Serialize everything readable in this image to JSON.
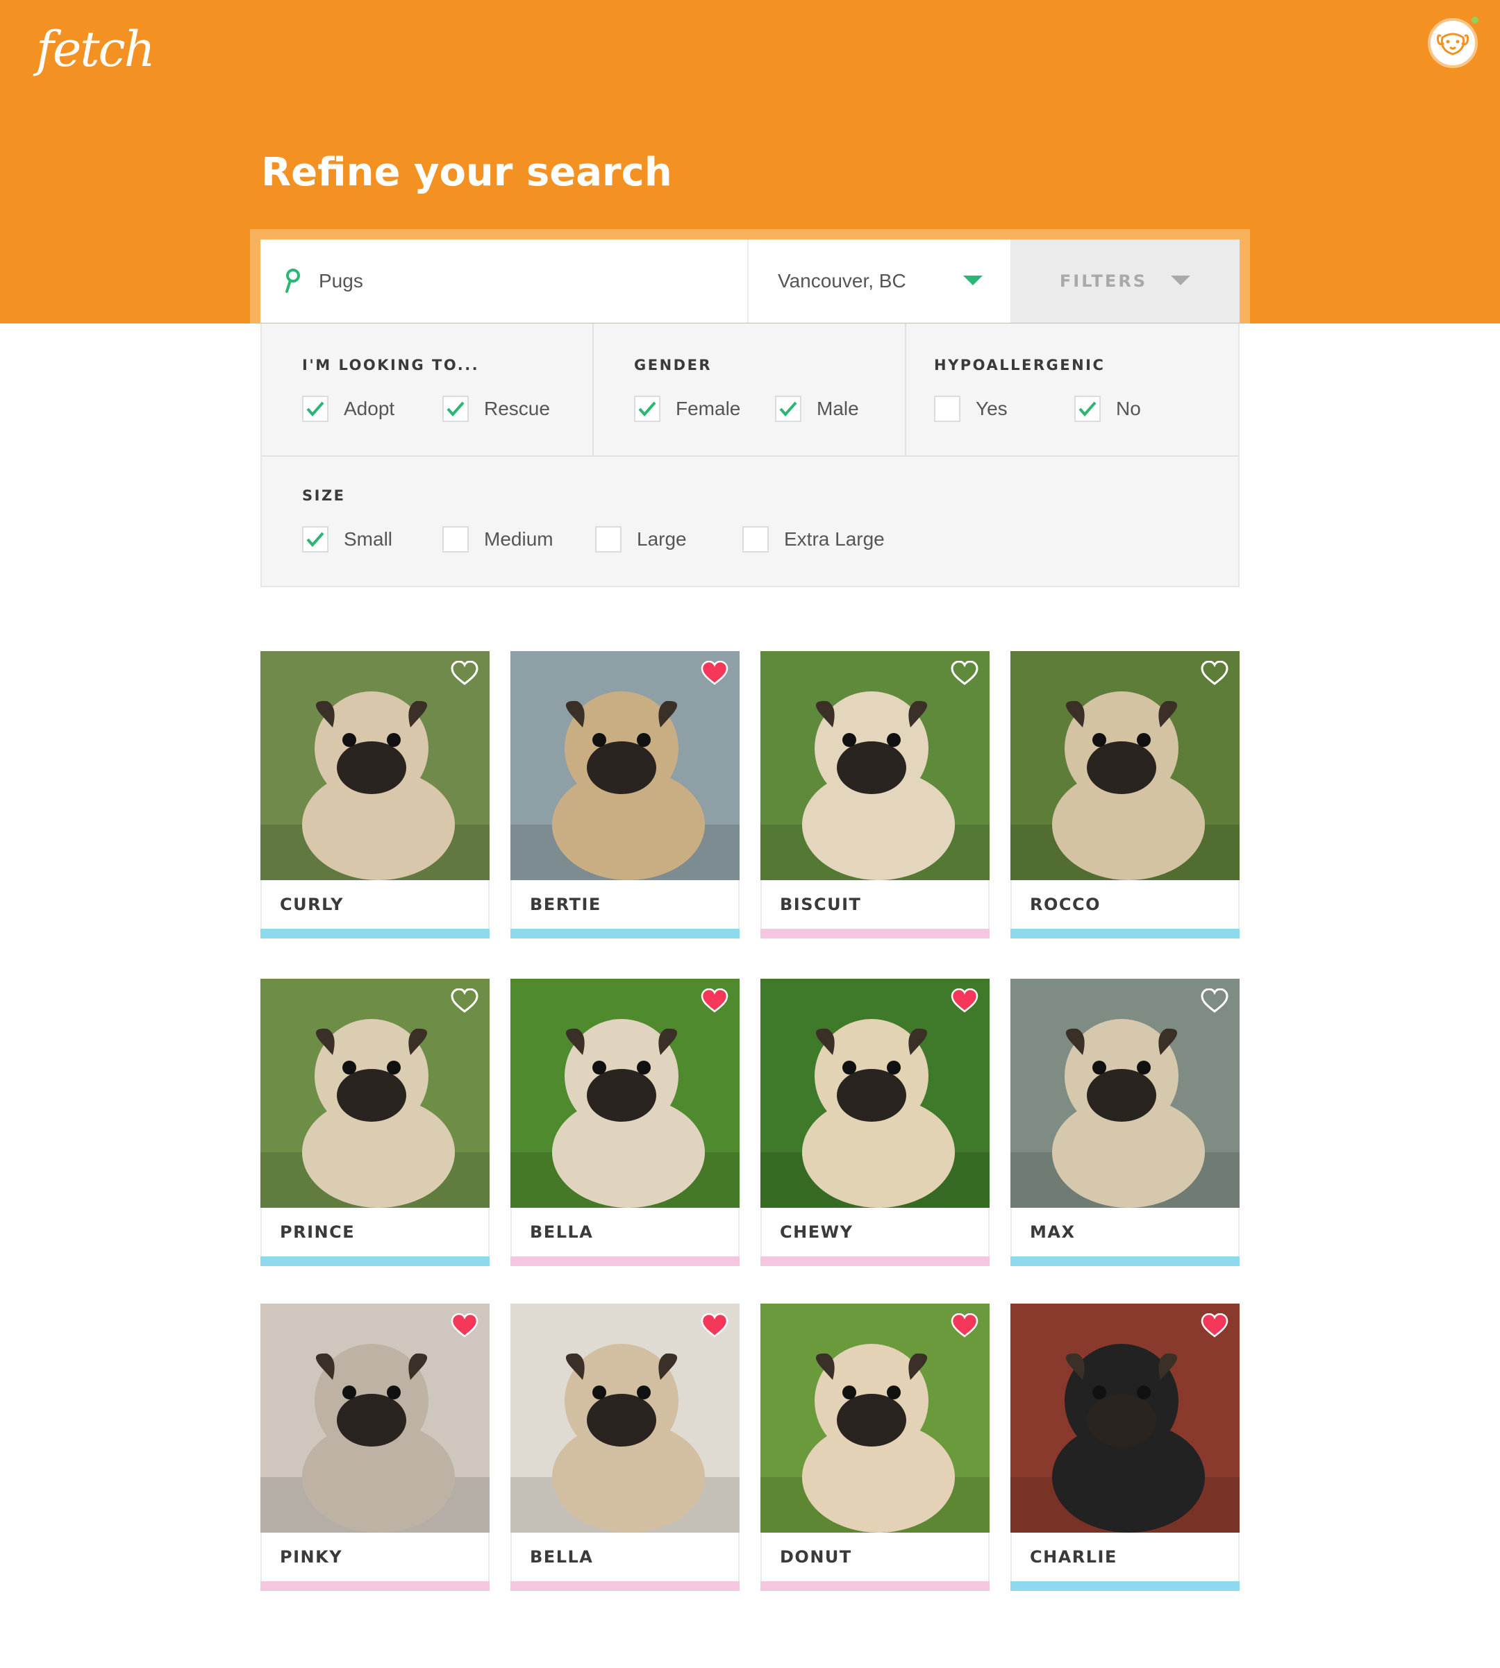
{
  "header": {
    "logo": "fetch",
    "title": "Refine your search",
    "brand_color": "#F39122"
  },
  "search": {
    "query": "Pugs",
    "location": "Vancouver, BC",
    "filters_label": "FILTERS"
  },
  "filters": {
    "looking_to": {
      "label": "I'M LOOKING TO...",
      "options": [
        {
          "label": "Adopt",
          "checked": true
        },
        {
          "label": "Rescue",
          "checked": true
        }
      ]
    },
    "gender": {
      "label": "GENDER",
      "options": [
        {
          "label": "Female",
          "checked": true
        },
        {
          "label": "Male",
          "checked": true
        }
      ]
    },
    "hypoallergenic": {
      "label": "HYPOALLERGENIC",
      "options": [
        {
          "label": "Yes",
          "checked": false
        },
        {
          "label": "No",
          "checked": true
        }
      ]
    },
    "size": {
      "label": "SIZE",
      "options": [
        {
          "label": "Small",
          "checked": true
        },
        {
          "label": "Medium",
          "checked": false
        },
        {
          "label": "Large",
          "checked": false
        },
        {
          "label": "Extra Large",
          "checked": false
        }
      ]
    }
  },
  "colors": {
    "check": "#2BB673",
    "male": "#8ED9EE",
    "female": "#F4C6E0",
    "heart_active": "#F5385A"
  },
  "pets": [
    {
      "name": "CURLY",
      "favorited": false,
      "gender": "male",
      "bg": "#6f8a4a",
      "fur": "#d8c7ab"
    },
    {
      "name": "BERTIE",
      "favorited": true,
      "gender": "male",
      "bg": "#8ea0a6",
      "fur": "#c9ae84"
    },
    {
      "name": "BISCUIT",
      "favorited": false,
      "gender": "female",
      "bg": "#5f8a3c",
      "fur": "#e3d6bd"
    },
    {
      "name": "ROCCO",
      "favorited": false,
      "gender": "male",
      "bg": "#5d7d38",
      "fur": "#d3c3a2"
    },
    {
      "name": "PRINCE",
      "favorited": false,
      "gender": "male",
      "bg": "#6e8e48",
      "fur": "#dbcdb2"
    },
    {
      "name": "BELLA",
      "favorited": true,
      "gender": "female",
      "bg": "#4f8a2e",
      "fur": "#e0d4bf"
    },
    {
      "name": "CHEWY",
      "favorited": true,
      "gender": "female",
      "bg": "#3f7a2a",
      "fur": "#e2d3b4"
    },
    {
      "name": "MAX",
      "favorited": false,
      "gender": "male",
      "bg": "#7f8c83",
      "fur": "#d6c8ad"
    },
    {
      "name": "PINKY",
      "favorited": true,
      "gender": "female",
      "bg": "#cfc7bd",
      "fur": "#bdb2a3"
    },
    {
      "name": "BELLA",
      "favorited": true,
      "gender": "female",
      "bg": "#e0dbd2",
      "fur": "#d2bea0"
    },
    {
      "name": "DONUT",
      "favorited": true,
      "gender": "female",
      "bg": "#6b9a3c",
      "fur": "#e3d2b5"
    },
    {
      "name": "CHARLIE",
      "favorited": true,
      "gender": "male",
      "bg": "#8a3a2c",
      "fur": "#222222"
    }
  ]
}
